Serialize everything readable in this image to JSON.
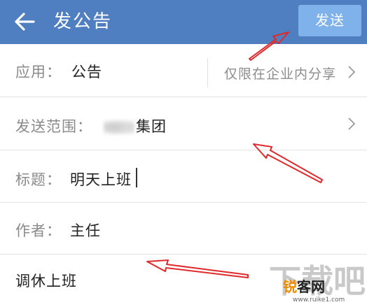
{
  "header": {
    "back_icon": "arrow-left-icon",
    "title": "发公告",
    "send_label": "发送",
    "bg_color": "#4f7fc0",
    "send_color": "#7fb1ea"
  },
  "form": {
    "app": {
      "label": "应用：",
      "value": "公告",
      "scope": "仅限在企业内分享"
    },
    "range": {
      "label": "发送范围：",
      "value": "集团"
    },
    "subject": {
      "label": "标题：",
      "value": "明天上班"
    },
    "author": {
      "label": "作者：",
      "value": "主任"
    },
    "body": {
      "value": "调休上班"
    }
  },
  "annotations": {
    "arrow_color": "#e0292b"
  },
  "watermark": {
    "brand_a": "锐",
    "brand_b": "客网",
    "url": "www.ruike1.com"
  }
}
